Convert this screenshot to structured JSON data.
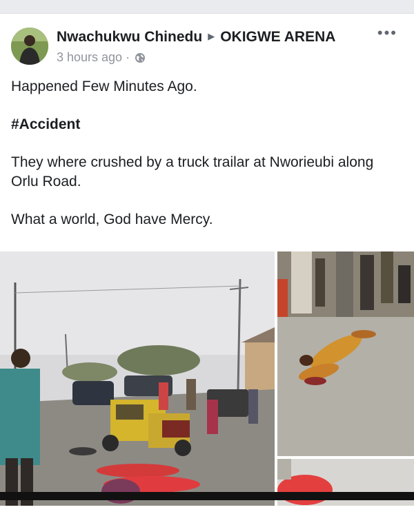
{
  "post": {
    "author": "Nwachukwu Chinedu",
    "group": "OKIGWE ARENA",
    "time": "3 hours ago",
    "separator": "·",
    "privacy_icon": "globe-icon",
    "more_icon": "more-options-icon",
    "lines": [
      "Happened Few Minutes Ago.",
      "#Accident",
      "They where crushed by a truck trailar at Nworieubi along Orlu Road.",
      "What a world, God have Mercy."
    ]
  },
  "photos": [
    {
      "name": "photo-street-scene"
    },
    {
      "name": "photo-victim-on-road"
    },
    {
      "name": "photo-partial"
    }
  ],
  "colors": {
    "feed_bg": "#e9ebee",
    "meta_text": "#90949c",
    "text": "#1c1e21"
  }
}
